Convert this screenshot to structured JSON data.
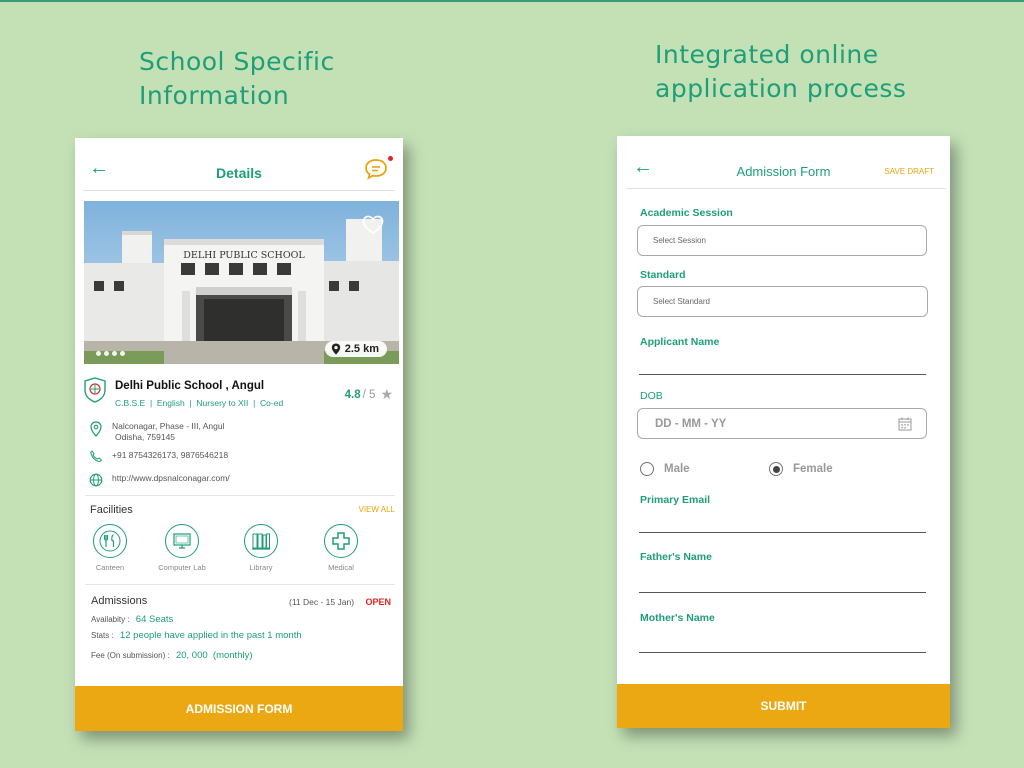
{
  "headings": {
    "left": [
      "School Specific",
      "Information"
    ],
    "right": [
      "Integrated online",
      "application process"
    ]
  },
  "details_screen": {
    "back_icon": "arrow-left-icon",
    "title": "Details",
    "chat_icon": "chat-bubble-icon",
    "hero_sign": "DELHI PUBLIC SCHOOL",
    "distance": "2.5 km",
    "school": {
      "name": "Delhi Public School , Angul",
      "tags": "C.B.S.E  |  English  |  Nursery to XII  |  Co-ed",
      "rating": "4.8",
      "rating_out": "/ 5",
      "address_line1": "Nalconagar, Phase - III, Angul",
      "address_line2": "Odisha, 759145",
      "phone": "+91 8754326173, 9876546218",
      "website": "http://www.dpsnalconagar.com/"
    },
    "facilities": {
      "title": "Facilities",
      "view_all": "VIEW ALL",
      "items": [
        {
          "label": "Canteen",
          "icon": "cutlery-icon"
        },
        {
          "label": "Computer Lab",
          "icon": "computer-icon"
        },
        {
          "label": "Library",
          "icon": "books-icon"
        },
        {
          "label": "Medical",
          "icon": "medical-cross-icon"
        }
      ]
    },
    "admissions": {
      "title": "Admissions",
      "dates": "(11 Dec - 15 Jan)",
      "status": "OPEN",
      "availability_label": "Availabity :",
      "availability_value": "64 Seats",
      "stats_label": "Stats :",
      "stats_value": "12 people have applied in the past 1 month",
      "fee_label": "Fee (On submission) :",
      "fee_value": "20, 000  (monthly)"
    },
    "button": "ADMISSION FORM"
  },
  "form_screen": {
    "back_icon": "arrow-left-icon",
    "title": "Admission Form",
    "save_draft": "SAVE DRAFT",
    "academic_session": {
      "label": "Academic Session",
      "placeholder": "Select Session"
    },
    "standard": {
      "label": "Standard",
      "placeholder": "Select Standard"
    },
    "applicant_name": {
      "label": "Applicant Name"
    },
    "dob": {
      "label": "DOB",
      "placeholder": "DD - MM - YY"
    },
    "gender": {
      "male": "Male",
      "female": "Female",
      "selected": "Female"
    },
    "primary_email": {
      "label": "Primary Email"
    },
    "fathers_name": {
      "label": "Father's Name"
    },
    "mothers_name": {
      "label": "Mother's Name"
    },
    "button": "SUBMIT"
  },
  "colors": {
    "background": "#c4e1b6",
    "accent_green": "#1e9e79",
    "accent_orange": "#eca812",
    "status_red": "#e52121"
  }
}
